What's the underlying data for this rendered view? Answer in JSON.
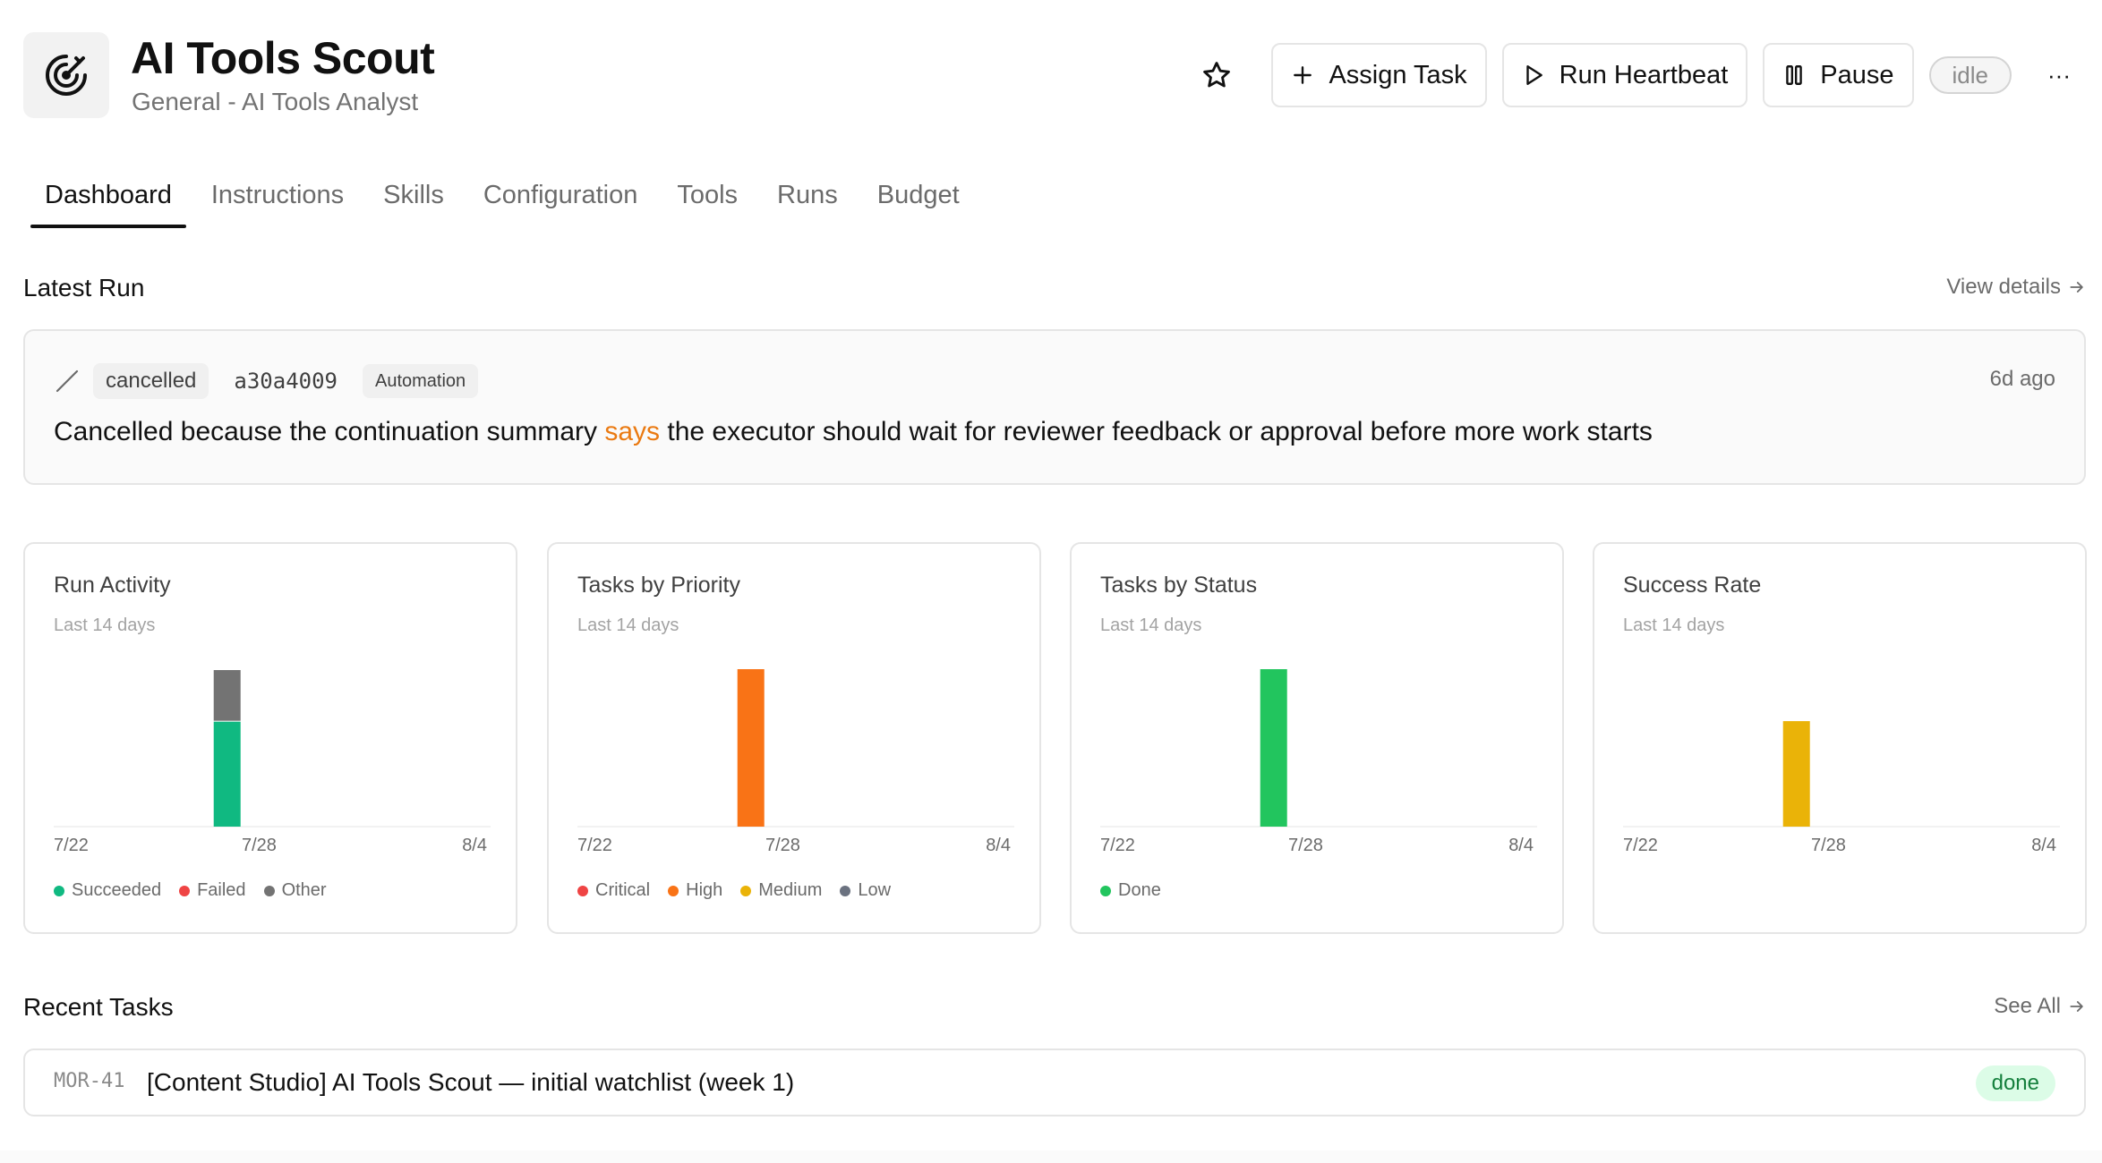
{
  "agent": {
    "name": "AI Tools Scout",
    "subtitle": "General - AI Tools Analyst",
    "icon": "radar-target-icon",
    "status": "idle"
  },
  "actions": {
    "favorite_icon": "star-icon",
    "assign_task": "Assign Task",
    "run_heartbeat": "Run Heartbeat",
    "pause": "Pause",
    "more": "···"
  },
  "tabs": [
    {
      "label": "Dashboard",
      "active": true
    },
    {
      "label": "Instructions",
      "active": false
    },
    {
      "label": "Skills",
      "active": false
    },
    {
      "label": "Configuration",
      "active": false
    },
    {
      "label": "Tools",
      "active": false
    },
    {
      "label": "Runs",
      "active": false
    },
    {
      "label": "Budget",
      "active": false
    }
  ],
  "latest_run": {
    "heading": "Latest Run",
    "view_details": "View details",
    "status": "cancelled",
    "run_id": "a30a4009",
    "trigger": "Automation",
    "time_ago": "6d ago",
    "summary_before": "Cancelled because the continuation summary ",
    "summary_highlight": "says",
    "summary_after": " the executor should wait for reviewer feedback or approval before more work starts"
  },
  "colors": {
    "succeeded": "#10b981",
    "failed": "#ef4444",
    "other": "#737373",
    "critical": "#ef4444",
    "high": "#f97316",
    "medium": "#eab308",
    "low": "#6b7280",
    "done": "#22c55e",
    "success_rate": "#eab308",
    "highlight": "#ea7a12"
  },
  "chart_data": [
    {
      "type": "bar",
      "title": "Run Activity",
      "subtitle": "Last 14 days",
      "x_ticks": [
        "7/22",
        "7/28",
        "8/4"
      ],
      "categories": [
        "7/22",
        "7/23",
        "7/24",
        "7/25",
        "7/26",
        "7/27",
        "7/28",
        "7/29",
        "7/30",
        "7/31",
        "8/1",
        "8/2",
        "8/3",
        "8/4"
      ],
      "stacked": true,
      "series": [
        {
          "name": "Succeeded",
          "color": "#10b981",
          "values": [
            0,
            0,
            0,
            0,
            0,
            2,
            0,
            0,
            0,
            0,
            0,
            0,
            0,
            0
          ]
        },
        {
          "name": "Failed",
          "color": "#ef4444",
          "values": [
            0,
            0,
            0,
            0,
            0,
            0,
            0,
            0,
            0,
            0,
            0,
            0,
            0,
            0
          ]
        },
        {
          "name": "Other",
          "color": "#737373",
          "values": [
            0,
            0,
            0,
            0,
            0,
            1,
            0,
            0,
            0,
            0,
            0,
            0,
            0,
            0
          ]
        }
      ]
    },
    {
      "type": "bar",
      "title": "Tasks by Priority",
      "subtitle": "Last 14 days",
      "x_ticks": [
        "7/22",
        "7/28",
        "8/4"
      ],
      "categories": [
        "7/22",
        "7/23",
        "7/24",
        "7/25",
        "7/26",
        "7/27",
        "7/28",
        "7/29",
        "7/30",
        "7/31",
        "8/1",
        "8/2",
        "8/3",
        "8/4"
      ],
      "stacked": true,
      "series": [
        {
          "name": "Critical",
          "color": "#ef4444",
          "values": [
            0,
            0,
            0,
            0,
            0,
            0,
            0,
            0,
            0,
            0,
            0,
            0,
            0,
            0
          ]
        },
        {
          "name": "High",
          "color": "#f97316",
          "values": [
            0,
            0,
            0,
            0,
            0,
            1,
            0,
            0,
            0,
            0,
            0,
            0,
            0,
            0
          ]
        },
        {
          "name": "Medium",
          "color": "#eab308",
          "values": [
            0,
            0,
            0,
            0,
            0,
            0,
            0,
            0,
            0,
            0,
            0,
            0,
            0,
            0
          ]
        },
        {
          "name": "Low",
          "color": "#6b7280",
          "values": [
            0,
            0,
            0,
            0,
            0,
            0,
            0,
            0,
            0,
            0,
            0,
            0,
            0,
            0
          ]
        }
      ]
    },
    {
      "type": "bar",
      "title": "Tasks by Status",
      "subtitle": "Last 14 days",
      "x_ticks": [
        "7/22",
        "7/28",
        "8/4"
      ],
      "categories": [
        "7/22",
        "7/23",
        "7/24",
        "7/25",
        "7/26",
        "7/27",
        "7/28",
        "7/29",
        "7/30",
        "7/31",
        "8/1",
        "8/2",
        "8/3",
        "8/4"
      ],
      "stacked": true,
      "series": [
        {
          "name": "Done",
          "color": "#22c55e",
          "values": [
            0,
            0,
            0,
            0,
            0,
            1,
            0,
            0,
            0,
            0,
            0,
            0,
            0,
            0
          ]
        }
      ]
    },
    {
      "type": "bar",
      "title": "Success Rate",
      "subtitle": "Last 14 days",
      "x_ticks": [
        "7/22",
        "7/28",
        "8/4"
      ],
      "categories": [
        "7/22",
        "7/23",
        "7/24",
        "7/25",
        "7/26",
        "7/27",
        "7/28",
        "7/29",
        "7/30",
        "7/31",
        "8/1",
        "8/2",
        "8/3",
        "8/4"
      ],
      "ylim": [
        0,
        100
      ],
      "series": [
        {
          "color": "#eab308",
          "values": [
            0,
            0,
            0,
            0,
            0,
            67,
            0,
            0,
            0,
            0,
            0,
            0,
            0,
            0
          ]
        }
      ]
    }
  ],
  "recent_tasks": {
    "heading": "Recent Tasks",
    "see_all": "See All",
    "items": [
      {
        "id": "MOR-41",
        "title": "[Content Studio] AI Tools Scout — initial watchlist (week 1)",
        "status": "done"
      }
    ]
  }
}
